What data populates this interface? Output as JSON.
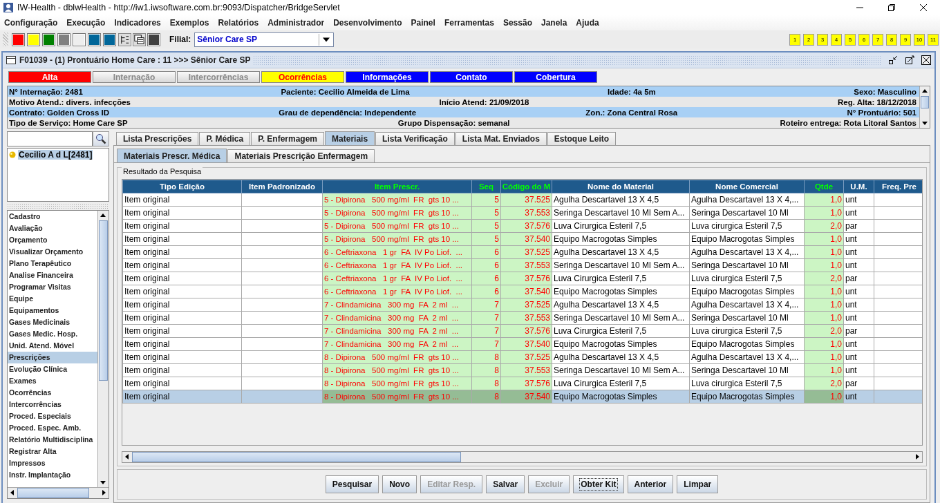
{
  "window": {
    "title": "IW-Health - dblwHealth - http://iw1.iwsoftware.com.br:9093/Dispatcher/BridgeServlet"
  },
  "menu": [
    "Configuração",
    "Execução",
    "Indicadores",
    "Exemplos",
    "Relatórios",
    "Administrador",
    "Desenvolvimento",
    "Painel",
    "Ferramentas",
    "Sessão",
    "Janela",
    "Ajuda"
  ],
  "toolbar": {
    "buttons": [
      {
        "kind": "swatch",
        "color": "#ff0000"
      },
      {
        "kind": "swatch",
        "color": "#ffff00"
      },
      {
        "kind": "swatch",
        "color": "#008000"
      },
      {
        "kind": "swatch",
        "color": "#808080"
      },
      {
        "kind": "swatch",
        "color": "#eeeeee"
      },
      {
        "kind": "swatch",
        "color": "#006699"
      },
      {
        "kind": "swatch",
        "color": "#006699"
      },
      {
        "kind": "text-icon"
      },
      {
        "kind": "grid-icon"
      },
      {
        "kind": "swatch",
        "color": "#404040"
      }
    ],
    "filial_label": "Filial:",
    "filial_value": "Sênior Care SP",
    "numbers": [
      "1",
      "2",
      "3",
      "4",
      "5",
      "6",
      "7",
      "8",
      "9",
      "10",
      "11"
    ]
  },
  "frame": {
    "title": "F01039 - (1) Prontuário Home Care : 11 >>> Sênior Care SP"
  },
  "status_buttons": [
    {
      "label": "Alta",
      "kind": "solid",
      "color": "#ff0000",
      "disabled": false
    },
    {
      "label": "Internação",
      "color": "#e6e6e6",
      "disabled": true
    },
    {
      "label": "Intercorrências",
      "color": "#e6e6e6",
      "disabled": true
    },
    {
      "label": "Ocorrências",
      "kind": "warning",
      "color": "#ffff00",
      "disabled": false
    },
    {
      "label": "Informações",
      "kind": "solid",
      "color": "#0000ff",
      "disabled": false
    },
    {
      "label": "Contato",
      "kind": "solid",
      "color": "#0000ff",
      "disabled": false
    },
    {
      "label": "Cobertura",
      "kind": "solid",
      "color": "#0000ff",
      "disabled": false
    }
  ],
  "info": [
    [
      {
        "label": "N° Internação:",
        "value": "2481"
      },
      {
        "label": "Paciente:",
        "value": "Cecilio Almeida de Lima"
      },
      {
        "label": "Idade:",
        "value": "4a 5m"
      },
      {
        "label": "Sexo:",
        "value": "Masculino"
      }
    ],
    [
      {
        "label": "Motivo Atend.:",
        "value": "divers. infecções"
      },
      {
        "label": "Início Atend:",
        "value": "21/09/2018"
      },
      {
        "label": "Reg. Alta:",
        "value": "18/12/2018"
      }
    ],
    [
      {
        "label": "Contrato:",
        "value": "Golden Cross ID"
      },
      {
        "label": "Grau de dependência:",
        "value": "Independente"
      },
      {
        "label": "Zon.:",
        "value": "Zona Central Rosa"
      },
      {
        "label": "N° Prontuário:",
        "value": "501"
      }
    ],
    [
      {
        "label": "Tipo de Serviço:",
        "value": "Home Care SP"
      },
      {
        "label": "Grupo Dispensação:",
        "value": "semanal"
      },
      {
        "label": "Roteiro entrega:",
        "value": "Rota Litoral Santos"
      }
    ]
  ],
  "sidebar": {
    "patients": [
      {
        "label": "Cecilio A d L[2481]",
        "selected": true
      }
    ],
    "items": [
      {
        "label": "Cadastro",
        "selected": false
      },
      {
        "label": "Avaliação",
        "selected": false
      },
      {
        "label": "Orçamento",
        "selected": false
      },
      {
        "label": "Visualizar Orçamento",
        "selected": false
      },
      {
        "label": "Plano Terapêutico",
        "selected": false
      },
      {
        "label": "Analise Financeira",
        "selected": false
      },
      {
        "label": "Programar Visitas",
        "selected": false
      },
      {
        "label": "Equipe",
        "selected": false
      },
      {
        "label": "Equipamentos",
        "selected": false
      },
      {
        "label": "Gases Medicinais",
        "selected": false
      },
      {
        "label": "Gases Medic. Hosp.",
        "selected": false
      },
      {
        "label": "Unid. Atend. Móvel",
        "selected": false
      },
      {
        "label": "Prescrições",
        "selected": true
      },
      {
        "label": "Evolução Clínica",
        "selected": false
      },
      {
        "label": "Exames",
        "selected": false
      },
      {
        "label": "Ocorrências",
        "selected": false
      },
      {
        "label": "Intercorrências",
        "selected": false
      },
      {
        "label": "Proced. Especiais",
        "selected": false
      },
      {
        "label": "Proced. Espec. Amb.",
        "selected": false
      },
      {
        "label": "Relatório Multidisciplina",
        "selected": false
      },
      {
        "label": "Registrar Alta",
        "selected": false
      },
      {
        "label": "Impressos",
        "selected": false
      },
      {
        "label": "Instr. Implantação",
        "selected": false
      }
    ]
  },
  "tabs": [
    {
      "label": "Lista Prescrições",
      "selected": false
    },
    {
      "label": "P. Médica",
      "selected": false
    },
    {
      "label": "P. Enfermagem",
      "selected": false
    },
    {
      "label": "Materiais",
      "selected": true
    },
    {
      "label": "Lista Verificação",
      "selected": false
    },
    {
      "label": "Lista Mat. Enviados",
      "selected": false
    },
    {
      "label": "Estoque Leito",
      "selected": false
    }
  ],
  "subtabs": [
    {
      "label": "Materiais Prescr. Médica",
      "selected": true
    },
    {
      "label": "Materiais Prescrição Enfermagem",
      "selected": false
    }
  ],
  "group_title": "Resultado da Pesquisa",
  "table": {
    "columns": [
      {
        "label": "Tipo Edição",
        "highlight": false
      },
      {
        "label": "Item Padronizado",
        "highlight": false
      },
      {
        "label": "Item Prescr.",
        "highlight": true
      },
      {
        "label": "Seq",
        "highlight": true
      },
      {
        "label": "Código do M",
        "highlight": true
      },
      {
        "label": "Nome do Material",
        "highlight": false
      },
      {
        "label": "Nome Comercial",
        "highlight": false
      },
      {
        "label": "Qtde",
        "highlight": true
      },
      {
        "label": "U.M.",
        "highlight": false
      },
      {
        "label": "Freq. Pre",
        "highlight": false
      }
    ],
    "rows": [
      {
        "tipo": "Item original",
        "item": "5 - Dipirona   500 mg/ml  FR  gts 10 ...",
        "seq": "5",
        "codigo": "37.525",
        "material": "Agulha Descartavel 13 X 4,5",
        "comercial": "Agulha Descartavel 13 X 4,...",
        "qtde": "1,0",
        "um": "unt",
        "selected": false
      },
      {
        "tipo": "Item original",
        "item": "5 - Dipirona   500 mg/ml  FR  gts 10 ...",
        "seq": "5",
        "codigo": "37.553",
        "material": "Seringa Descartavel 10 Ml Sem A...",
        "comercial": "Seringa Descartavel 10 Ml",
        "qtde": "1,0",
        "um": "unt",
        "selected": false
      },
      {
        "tipo": "Item original",
        "item": "5 - Dipirona   500 mg/ml  FR  gts 10 ...",
        "seq": "5",
        "codigo": "37.576",
        "material": "Luva Cirurgica Esteril 7,5",
        "comercial": "Luva cirurgica Esteril 7,5",
        "qtde": "2,0",
        "um": "par",
        "selected": false
      },
      {
        "tipo": "Item original",
        "item": "5 - Dipirona   500 mg/ml  FR  gts 10 ...",
        "seq": "5",
        "codigo": "37.540",
        "material": "Equipo Macrogotas Simples",
        "comercial": "Equipo Macrogotas Simples",
        "qtde": "1,0",
        "um": "unt",
        "selected": false
      },
      {
        "tipo": "Item original",
        "item": "6 - Ceftriaxona   1 gr  FA  IV Po Liof.  ...",
        "seq": "6",
        "codigo": "37.525",
        "material": "Agulha Descartavel 13 X 4,5",
        "comercial": "Agulha Descartavel 13 X 4,...",
        "qtde": "1,0",
        "um": "unt",
        "selected": false
      },
      {
        "tipo": "Item original",
        "item": "6 - Ceftriaxona   1 gr  FA  IV Po Liof.  ...",
        "seq": "6",
        "codigo": "37.553",
        "material": "Seringa Descartavel 10 Ml Sem A...",
        "comercial": "Seringa Descartavel 10 Ml",
        "qtde": "1,0",
        "um": "unt",
        "selected": false
      },
      {
        "tipo": "Item original",
        "item": "6 - Ceftriaxona   1 gr  FA  IV Po Liof.  ...",
        "seq": "6",
        "codigo": "37.576",
        "material": "Luva Cirurgica Esteril 7,5",
        "comercial": "Luva cirurgica Esteril 7,5",
        "qtde": "2,0",
        "um": "par",
        "selected": false
      },
      {
        "tipo": "Item original",
        "item": "6 - Ceftriaxona   1 gr  FA  IV Po Liof.  ...",
        "seq": "6",
        "codigo": "37.540",
        "material": "Equipo Macrogotas Simples",
        "comercial": "Equipo Macrogotas Simples",
        "qtde": "1,0",
        "um": "unt",
        "selected": false
      },
      {
        "tipo": "Item original",
        "item": "7 - Clindamicina   300 mg  FA  2 ml  ...",
        "seq": "7",
        "codigo": "37.525",
        "material": "Agulha Descartavel 13 X 4,5",
        "comercial": "Agulha Descartavel 13 X 4,...",
        "qtde": "1,0",
        "um": "unt",
        "selected": false
      },
      {
        "tipo": "Item original",
        "item": "7 - Clindamicina   300 mg  FA  2 ml  ...",
        "seq": "7",
        "codigo": "37.553",
        "material": "Seringa Descartavel 10 Ml Sem A...",
        "comercial": "Seringa Descartavel 10 Ml",
        "qtde": "1,0",
        "um": "unt",
        "selected": false
      },
      {
        "tipo": "Item original",
        "item": "7 - Clindamicina   300 mg  FA  2 ml  ...",
        "seq": "7",
        "codigo": "37.576",
        "material": "Luva Cirurgica Esteril 7,5",
        "comercial": "Luva cirurgica Esteril 7,5",
        "qtde": "2,0",
        "um": "par",
        "selected": false
      },
      {
        "tipo": "Item original",
        "item": "7 - Clindamicina   300 mg  FA  2 ml  ...",
        "seq": "7",
        "codigo": "37.540",
        "material": "Equipo Macrogotas Simples",
        "comercial": "Equipo Macrogotas Simples",
        "qtde": "1,0",
        "um": "unt",
        "selected": false
      },
      {
        "tipo": "Item original",
        "item": "8 - Dipirona   500 mg/ml  FR  gts 10 ...",
        "seq": "8",
        "codigo": "37.525",
        "material": "Agulha Descartavel 13 X 4,5",
        "comercial": "Agulha Descartavel 13 X 4,...",
        "qtde": "1,0",
        "um": "unt",
        "selected": false
      },
      {
        "tipo": "Item original",
        "item": "8 - Dipirona   500 mg/ml  FR  gts 10 ...",
        "seq": "8",
        "codigo": "37.553",
        "material": "Seringa Descartavel 10 Ml Sem A...",
        "comercial": "Seringa Descartavel 10 Ml",
        "qtde": "1,0",
        "um": "unt",
        "selected": false
      },
      {
        "tipo": "Item original",
        "item": "8 - Dipirona   500 mg/ml  FR  gts 10 ...",
        "seq": "8",
        "codigo": "37.576",
        "material": "Luva Cirurgica Esteril 7,5",
        "comercial": "Luva cirurgica Esteril 7,5",
        "qtde": "2,0",
        "um": "par",
        "selected": false
      },
      {
        "tipo": "Item original",
        "item": "8 - Dipirona   500 mg/ml  FR  gts 10 ...",
        "seq": "8",
        "codigo": "37.540",
        "material": "Equipo Macrogotas Simples",
        "comercial": "Equipo Macrogotas Simples",
        "qtde": "1,0",
        "um": "unt",
        "selected": true
      }
    ]
  },
  "buttons": [
    {
      "label": "Pesquisar",
      "disabled": false,
      "focused": false
    },
    {
      "label": "Novo",
      "disabled": false,
      "focused": false
    },
    {
      "label": "Editar Resp.",
      "disabled": true,
      "focused": false
    },
    {
      "label": "Salvar",
      "disabled": false,
      "focused": false
    },
    {
      "label": "Excluir",
      "disabled": true,
      "focused": false
    },
    {
      "label": "Obter Kit",
      "disabled": false,
      "focused": true
    },
    {
      "label": "Anterior",
      "disabled": false,
      "focused": false
    },
    {
      "label": "Limpar",
      "disabled": false,
      "focused": false
    }
  ]
}
